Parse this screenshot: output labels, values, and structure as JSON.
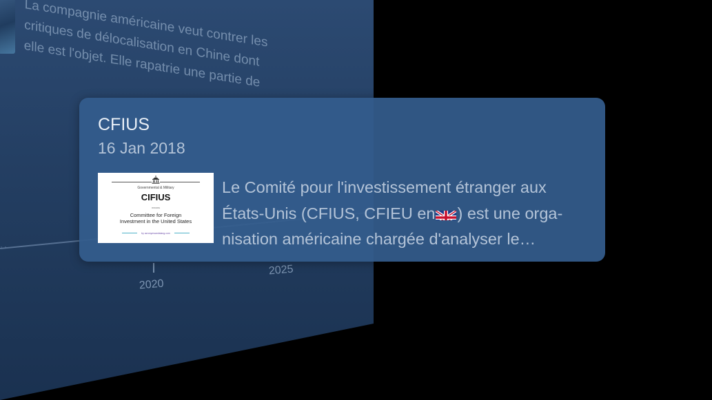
{
  "background": {
    "article_lines": [
      "La compagnie américaine veut contrer les",
      "critiques de délocalisation en Chine dont",
      "elle est l'objet. Elle rapatrie une partie de"
    ],
    "timeline_years": [
      "2020",
      "2025"
    ]
  },
  "card": {
    "title": "CFIUS",
    "date": "16 Jan 2018",
    "thumbnail": {
      "category": "Governmental & Military",
      "abbreviation": "CIFIUS",
      "means_label": "means",
      "full_name_line1": "Committee for Foreign",
      "full_name_line2": "Investment in the United States",
      "footer": "by acronymsandslang.com",
      "icon": "capitol-building-icon"
    },
    "description_line1": "Le Comité pour l'investissement étranger aux",
    "description_line2a": "États-Unis (CFIUS, CFIEU en",
    "description_flag": "uk-flag-icon",
    "description_line2b": ") est une orga-",
    "description_line3": "nisation américaine chargée d'analyser le…"
  },
  "colors": {
    "card_background": "#345c8d",
    "title_text": "#eaf0f7",
    "secondary_text": "#b4c4d8",
    "background_panel": "#243f63"
  }
}
